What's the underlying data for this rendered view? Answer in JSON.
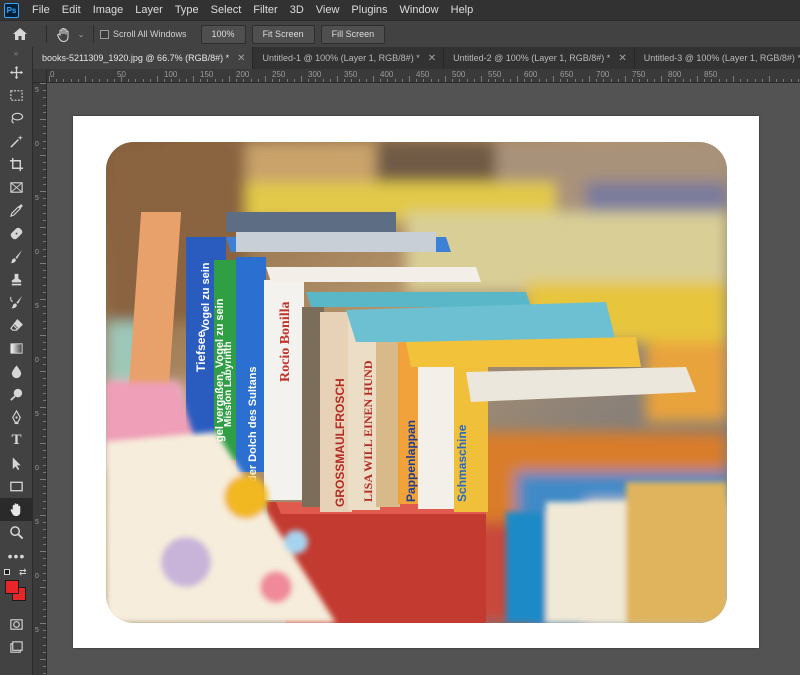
{
  "menubar": {
    "logo": "Ps",
    "items": [
      "File",
      "Edit",
      "Image",
      "Layer",
      "Type",
      "Select",
      "Filter",
      "3D",
      "View",
      "Plugins",
      "Window",
      "Help"
    ]
  },
  "options": {
    "home_icon": "home-icon",
    "hand_icon": "hand-icon",
    "scroll_all_label": "Scroll All Windows",
    "zoom_btn": "100%",
    "fit_btn": "Fit Screen",
    "fill_btn": "Fill Screen"
  },
  "tabs": [
    {
      "label": "books-5211309_1920.jpg @ 66.7% (RGB/8#) *",
      "active": true
    },
    {
      "label": "Untitled-1 @ 100% (Layer 1, RGB/8#) *",
      "active": false
    },
    {
      "label": "Untitled-2 @ 100% (Layer 1, RGB/8#) *",
      "active": false
    },
    {
      "label": "Untitled-3 @ 100% (Layer 1, RGB/8#) *",
      "active": false
    }
  ],
  "ruler_h": [
    "0",
    "50",
    "100",
    "150",
    "200",
    "250",
    "300",
    "350",
    "400",
    "450",
    "500",
    "550",
    "600",
    "650",
    "700",
    "750",
    "800",
    "850"
  ],
  "ruler_v": [
    "5",
    "0",
    "5",
    "0",
    "5",
    "0",
    "5",
    "0",
    "5",
    "0",
    "5"
  ],
  "tools": [
    "move-icon",
    "marquee-icon",
    "lasso-icon",
    "magic-wand-icon",
    "crop-icon",
    "frame-icon",
    "eyedropper-icon",
    "healing-brush-icon",
    "brush-icon",
    "clone-stamp-icon",
    "history-brush-icon",
    "eraser-icon",
    "gradient-icon",
    "blur-icon",
    "dodge-icon",
    "pen-icon",
    "type-icon",
    "path-selection-icon",
    "rectangle-icon",
    "hand-icon",
    "zoom-icon",
    "more-tools-icon"
  ],
  "colors": {
    "foreground": "#e8262a",
    "background": "#e8262a",
    "accent": "#31a8ff"
  },
  "book_spines": [
    "Tiefsee",
    "Vogel zu sein",
    "gel vergaßen, Vogel zu sein",
    "Mission Labyrinth",
    "der Dolch des Sultans",
    "Rocio Bonilla",
    "GROSSMAULFROSCH",
    "LISA WILL EINEN HUND",
    "Pappenlappan",
    "Schmaschine"
  ]
}
